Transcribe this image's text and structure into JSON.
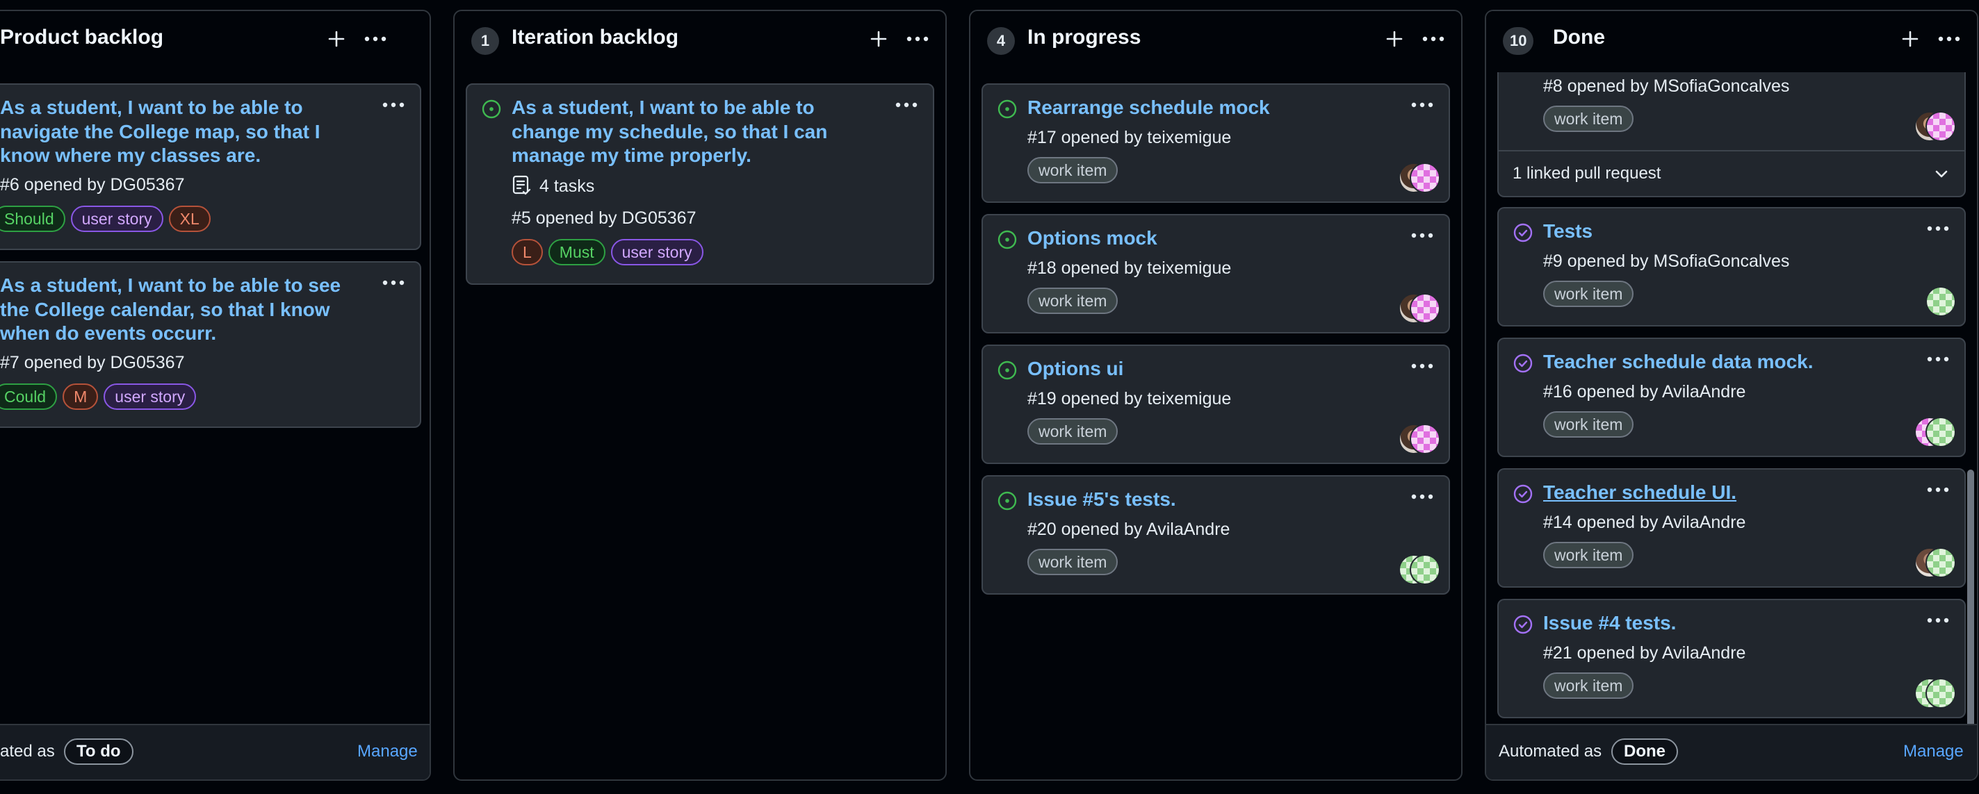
{
  "columns": [
    {
      "title": "Product backlog",
      "add_icon": "plus-icon",
      "menu_icon": "kebab-horizontal-icon",
      "cards": [
        {
          "title": "As a student, I want to be able to navigate the College map, so that I know where my classes are.",
          "meta": "#6 opened by DG05367",
          "labels": [
            "Should",
            "user story",
            "XL"
          ]
        },
        {
          "title": "As a student, I want to be able to see the College calendar, so that I know when do events occurr.",
          "meta": "#7 opened by DG05367",
          "labels": [
            "Could",
            "M",
            "user story"
          ]
        }
      ],
      "footer": {
        "automated_text": "ated as",
        "state": "To do",
        "manage": "Manage"
      }
    },
    {
      "count": "1",
      "title": "Iteration backlog",
      "add_icon": "plus-icon",
      "menu_icon": "kebab-horizontal-icon",
      "cards": [
        {
          "status_icon": "issue-opened-icon",
          "title": "As a student, I want to be able to change my schedule, so that I can manage my time properly.",
          "tasks": "4 tasks",
          "tasks_icon": "tasklist-icon",
          "meta": "#5 opened by DG05367",
          "labels": [
            "L",
            "Must",
            "user story"
          ]
        }
      ]
    },
    {
      "count": "4",
      "title": "In progress",
      "add_icon": "plus-icon",
      "menu_icon": "kebab-horizontal-icon",
      "cards": [
        {
          "status_icon": "issue-opened-icon",
          "title": "Rearrange schedule mock",
          "meta": "#17 opened by teixemigue",
          "label": "work item"
        },
        {
          "status_icon": "issue-opened-icon",
          "title": "Options mock",
          "meta": "#18 opened by teixemigue",
          "label": "work item"
        },
        {
          "status_icon": "issue-opened-icon",
          "title": "Options ui",
          "meta": "#19 opened by teixemigue",
          "label": "work item"
        },
        {
          "status_icon": "issue-opened-icon",
          "title": "Issue #5's tests.",
          "meta": "#20 opened by AvilaAndre",
          "label": "work item"
        }
      ]
    },
    {
      "count": "10",
      "title": "Done",
      "add_icon": "plus-icon",
      "menu_icon": "kebab-horizontal-icon",
      "cards": [
        {
          "meta": "#8 opened by MSofiaGoncalves",
          "label": "work item",
          "linked_pr": "1 linked pull request",
          "chevron_icon": "chevron-down-icon"
        },
        {
          "status_icon": "issue-closed-icon",
          "title": "Tests",
          "meta": "#9 opened by MSofiaGoncalves",
          "label": "work item"
        },
        {
          "status_icon": "issue-closed-icon",
          "title": "Teacher schedule data mock.",
          "meta": "#16 opened by AvilaAndre",
          "label": "work item"
        },
        {
          "status_icon": "issue-closed-icon",
          "title": "Teacher schedule UI.",
          "meta": "#14 opened by AvilaAndre",
          "label": "work item"
        },
        {
          "status_icon": "issue-closed-icon",
          "title": "Issue #4 tests.",
          "meta": "#21 opened by AvilaAndre",
          "label": "work item"
        }
      ],
      "footer": {
        "automated_text": "Automated as",
        "state": "Done",
        "manage": "Manage"
      }
    }
  ],
  "colors": {
    "background": "#010409",
    "card": "#21262d",
    "link": "#79c0ff",
    "open_green": "#3fb950",
    "closed_purple": "#a371f7",
    "label_green": "#3fb950",
    "label_purple": "#d2a8ff",
    "label_red": "#f0886b",
    "label_gray": "#c9d1d9"
  }
}
